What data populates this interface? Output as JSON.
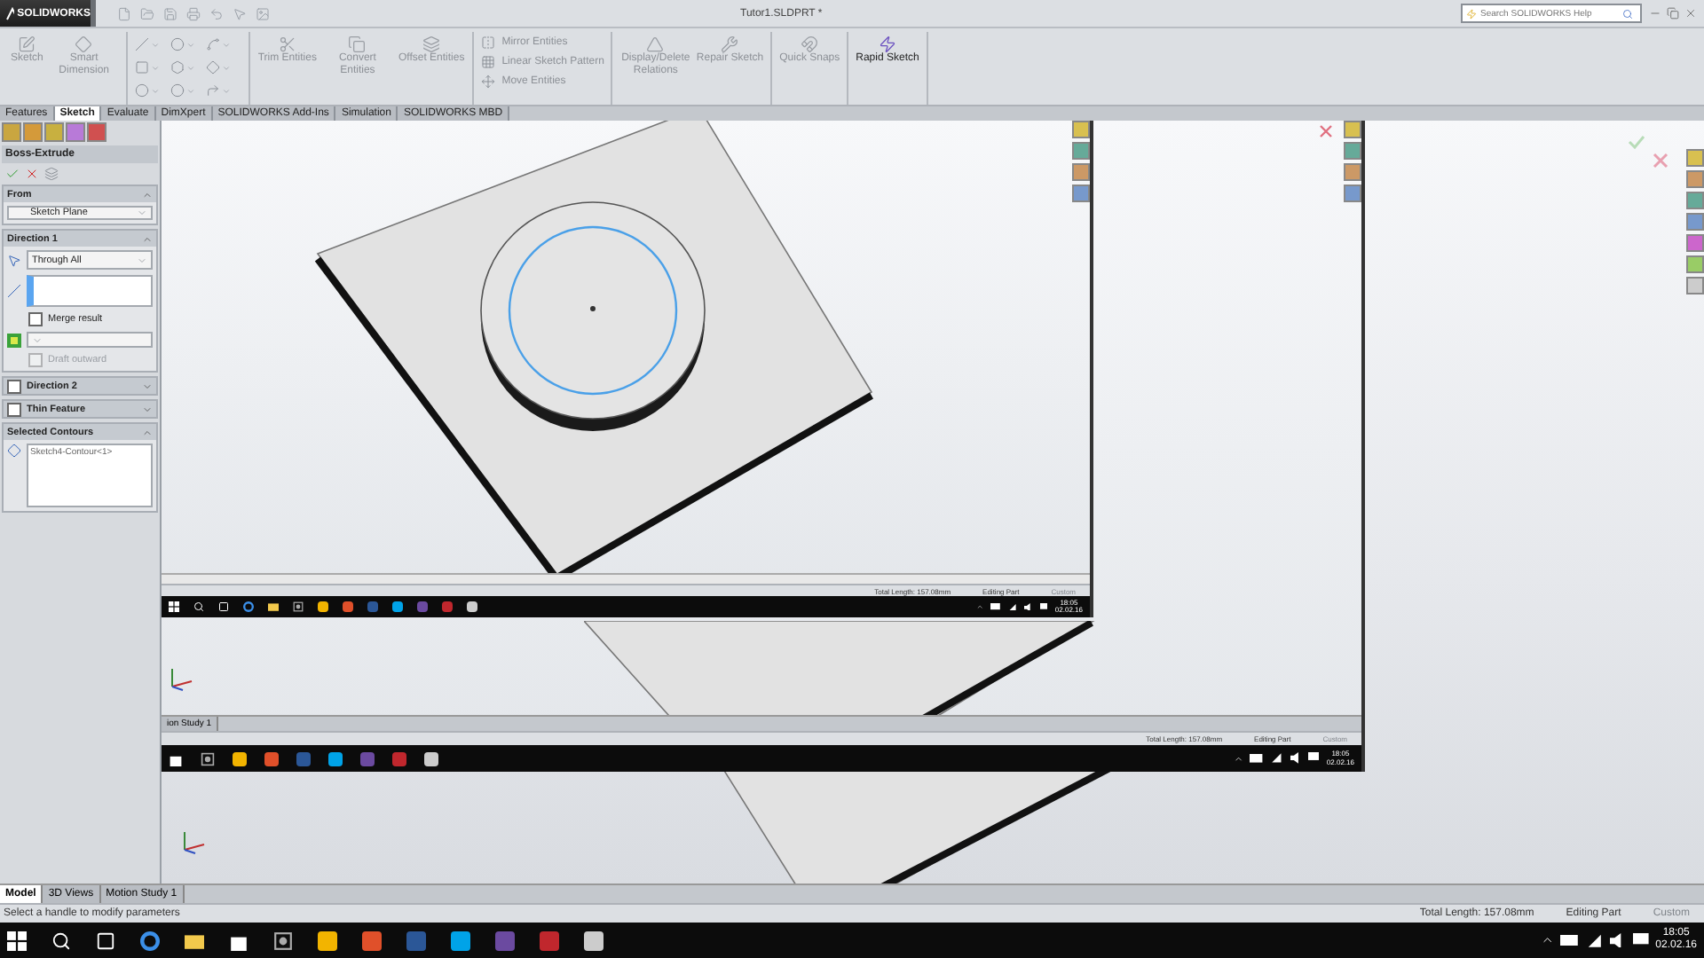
{
  "title_bar": {
    "logo": "SOLIDWORKS",
    "document": "Tutor1.SLDPRT *",
    "search": {
      "placeholder": "Search SOLIDWORKS Help"
    }
  },
  "ribbon": {
    "groups": [
      {
        "kind": "large",
        "tools": [
          {
            "label": "Sketch",
            "disabled": true
          },
          {
            "label": "Smart Dimension",
            "disabled": true
          }
        ]
      },
      {
        "kind": "grid"
      },
      {
        "kind": "large",
        "tools": [
          {
            "label": "Trim Entities",
            "disabled": true
          },
          {
            "label": "Convert Entities",
            "disabled": true
          },
          {
            "label": "Offset Entities",
            "disabled": true
          }
        ]
      },
      {
        "kind": "list",
        "tools": [
          {
            "label": "Mirror Entities",
            "disabled": true
          },
          {
            "label": "Linear Sketch Pattern",
            "disabled": true
          },
          {
            "label": "Move Entities",
            "disabled": true
          }
        ]
      },
      {
        "kind": "large",
        "tools": [
          {
            "label": "Display/Delete Relations",
            "disabled": true
          },
          {
            "label": "Repair Sketch",
            "disabled": true
          }
        ]
      },
      {
        "kind": "large",
        "tools": [
          {
            "label": "Quick Snaps",
            "disabled": true
          }
        ]
      },
      {
        "kind": "large",
        "tools": [
          {
            "label": "Rapid Sketch",
            "disabled": false
          }
        ]
      }
    ]
  },
  "command_tabs": [
    {
      "label": "Features",
      "selected": false
    },
    {
      "label": "Sketch",
      "selected": true
    },
    {
      "label": "Evaluate",
      "selected": false
    },
    {
      "label": "DimXpert",
      "selected": false
    },
    {
      "label": "SOLIDWORKS Add-Ins",
      "selected": false
    },
    {
      "label": "Simulation",
      "selected": false
    },
    {
      "label": "SOLIDWORKS MBD",
      "selected": false
    }
  ],
  "property_manager": {
    "title": "Boss-Extrude",
    "sections": [
      {
        "kind": "from",
        "title": "From",
        "expanded": true,
        "select": "Sketch Plane"
      },
      {
        "kind": "direction",
        "title": "Direction 1",
        "expanded": true,
        "select": "Through All",
        "merge": {
          "label": "Merge result",
          "checked": false
        },
        "draft": {
          "label": "Draft outward",
          "disabled": true
        }
      },
      {
        "kind": "toggle",
        "title": "Direction 2",
        "expanded": false,
        "checked": false
      },
      {
        "kind": "toggle",
        "title": "Thin Feature",
        "expanded": false,
        "checked": false
      },
      {
        "kind": "list",
        "title": "Selected Contours",
        "expanded": true,
        "items": [
          "Sketch4-Contour<1>"
        ]
      }
    ]
  },
  "viewport": {
    "screens": [
      {
        "tab": "ion Study 1",
        "status": [
          {
            "text": "Total Length: 157.08mm",
            "disabled": false
          },
          {
            "text": "Editing Part",
            "disabled": false
          },
          {
            "text": "Custom",
            "disabled": true
          }
        ],
        "clock": {
          "time": "18:05",
          "date": "02.02.16"
        }
      },
      {
        "status": [
          {
            "text": "Total Length: 157.08mm",
            "disabled": false
          },
          {
            "text": "Editing Part",
            "disabled": false
          },
          {
            "text": "Custom",
            "disabled": true
          }
        ],
        "clock": {
          "time": "18:05",
          "date": "02.02.16"
        }
      }
    ]
  },
  "bottom_tabs": [
    {
      "label": "Model",
      "selected": true
    },
    {
      "label": "3D Views",
      "selected": false
    },
    {
      "label": "Motion Study 1",
      "selected": false
    }
  ],
  "status_bar": {
    "message": "Select a handle to modify parameters",
    "fields": [
      {
        "text": "Total Length: 157.08mm",
        "disabled": false
      },
      {
        "text": "Editing Part",
        "disabled": false
      },
      {
        "text": "Custom",
        "disabled": true
      }
    ]
  },
  "taskbar": {
    "clock": {
      "time": "18:05",
      "date": "02.02.16"
    }
  }
}
